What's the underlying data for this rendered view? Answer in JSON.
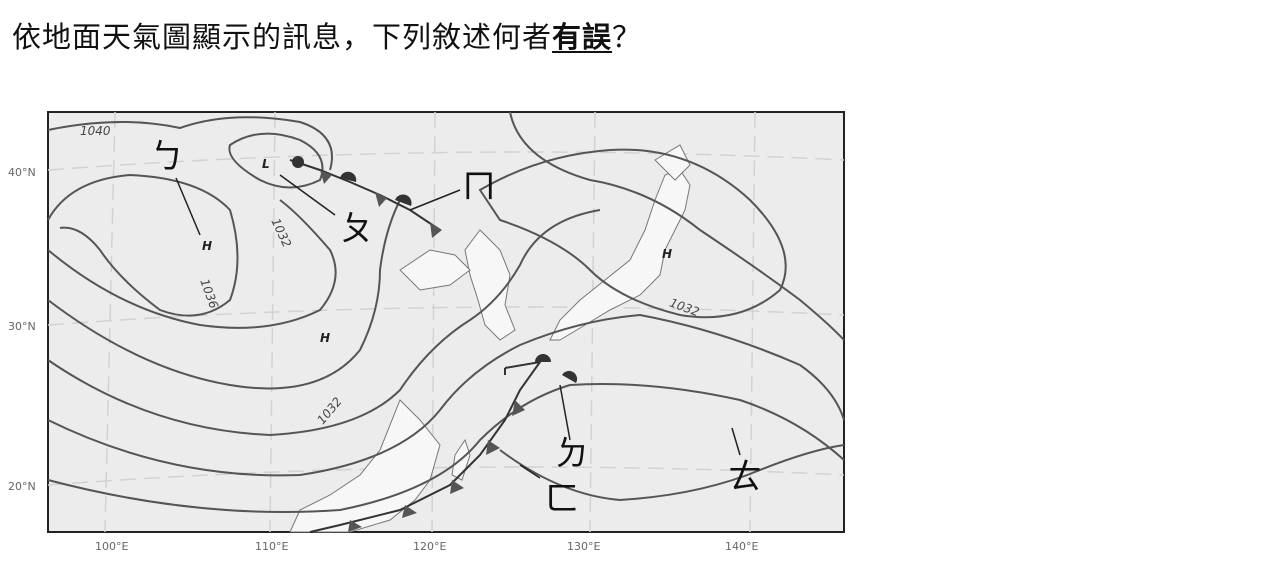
{
  "question": {
    "prefix": "依地面天氣圖顯示的訊息，下列敘述何者",
    "emphasis": "有誤",
    "suffix": "？"
  },
  "map": {
    "lat_labels": [
      "40°N",
      "30°N",
      "20°N"
    ],
    "lon_labels": [
      "100°E",
      "110°E",
      "120°E",
      "130°E",
      "140°E"
    ],
    "isobar_labels": [
      "1040",
      "1032",
      "1036",
      "1032",
      "1032"
    ],
    "pressure_centers": [
      "L",
      "H",
      "H",
      "H"
    ],
    "markers": [
      "ㄅ",
      "ㄆ",
      "ㄇ",
      "ㄈ",
      "ㄉ",
      "ㄊ"
    ]
  }
}
